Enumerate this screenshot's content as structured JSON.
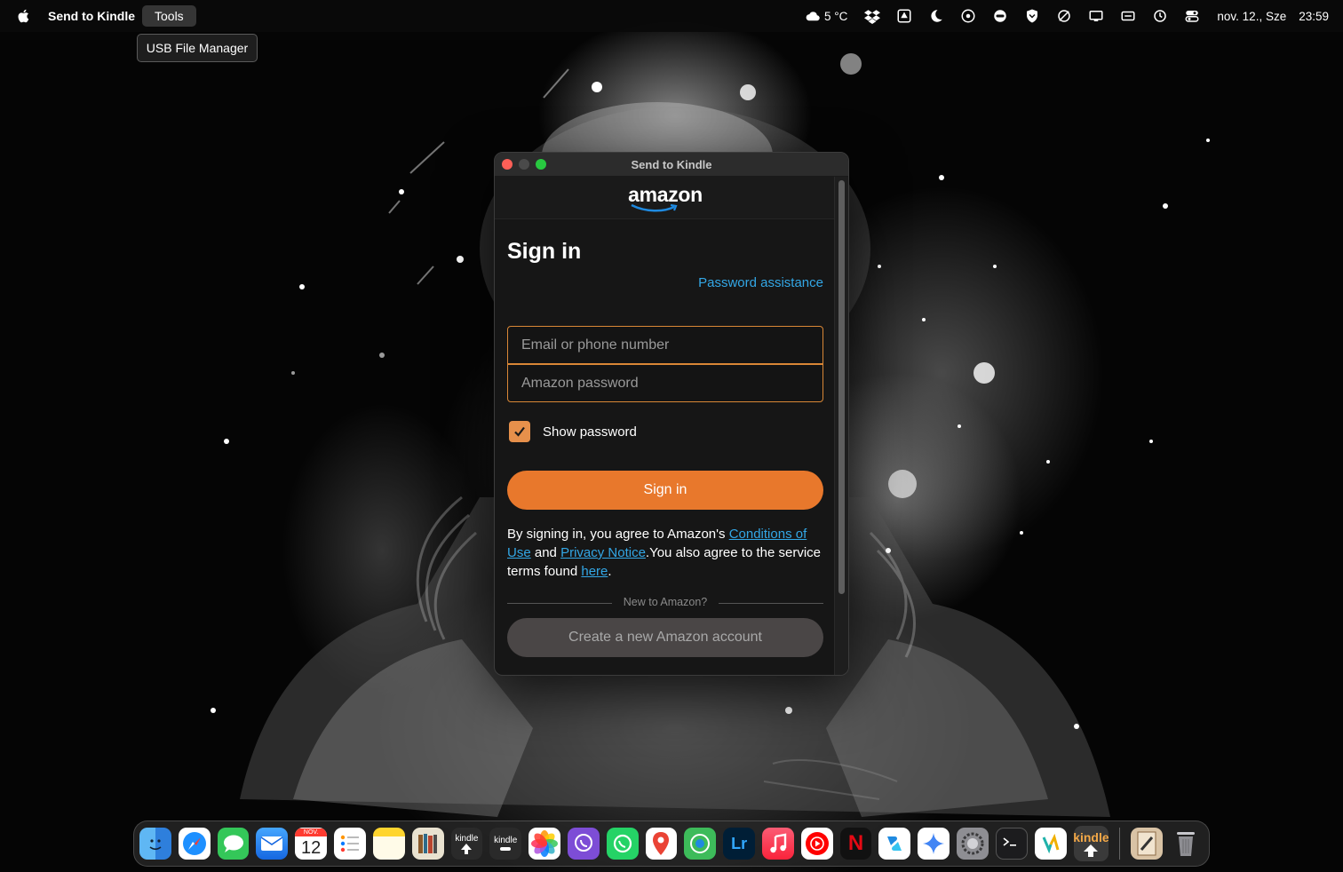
{
  "menubar": {
    "app_name": "Send to Kindle",
    "menu_tools": "Tools",
    "weather": "5 °C",
    "date": "nov. 12., Sze",
    "time": "23:59",
    "status_icons": [
      "cloud-icon",
      "dropbox-icon",
      "google-drive-icon",
      "moon-icon",
      "viber-status-icon",
      "gamepad-icon",
      "vpn-shield-icon",
      "no-sync-icon",
      "display-icon",
      "keyboard-input-icon",
      "time-machine-icon",
      "control-center-icon"
    ]
  },
  "tools_menu": {
    "item_usb": "USB File Manager"
  },
  "window": {
    "title": "Send to Kindle",
    "logo_text": "amazon",
    "heading": "Sign in",
    "password_assistance": "Password assistance",
    "email_placeholder": "Email or phone number",
    "password_placeholder": "Amazon password",
    "show_password_label": "Show password",
    "show_password_checked": true,
    "signin_button": "Sign in",
    "legal": {
      "part1": "By signing in, you agree to Amazon's ",
      "link_conditions": "Conditions of Use",
      "part2": " and ",
      "link_privacy": "Privacy Notice",
      "part3": ".You also agree to the service terms found ",
      "link_here": "here",
      "part4": "."
    },
    "divider_text": "New to Amazon?",
    "create_account_button": "Create a new Amazon account"
  },
  "dock": {
    "calendar_month": "NOV.",
    "calendar_day": "12",
    "kindle_label": "kindle",
    "apps": [
      "Finder",
      "Safari",
      "Messages",
      "Mail",
      "Calendar",
      "Reminders",
      "Notes",
      "Books",
      "Kindle Uploader",
      "Kindle USB",
      "Photos",
      "Viber",
      "WhatsApp",
      "Maps",
      "Find My",
      "Lightroom",
      "Music",
      "YouTube Music",
      "Netflix",
      "Copilot",
      "Gemini",
      "System Settings",
      "Terminal",
      "Vidmore",
      "Send to Kindle",
      "Preview",
      "Trash"
    ]
  },
  "colors": {
    "accent_orange": "#e8782c",
    "link_blue": "#33a7e6",
    "input_border": "#d98736",
    "checkbox": "#e6904b"
  }
}
